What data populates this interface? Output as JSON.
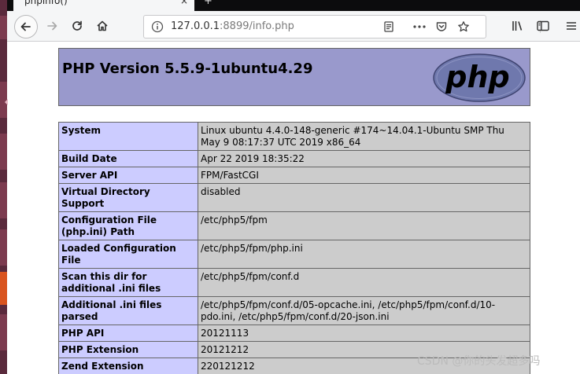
{
  "browser": {
    "tab_title": "phpinfo()",
    "tab_close": "×",
    "tab_new": "+",
    "url_host": "127.0.0.1",
    "url_rest": ":8899/info.php",
    "icons": [
      "back-icon",
      "forward-icon",
      "reload-icon",
      "home-icon",
      "info-icon",
      "reader-view-icon",
      "more-icon",
      "pocket-icon",
      "bookmark-star-icon",
      "library-icon",
      "sidebar-icon",
      "menu-icon"
    ]
  },
  "page": {
    "title": "PHP Version 5.5.9-1ubuntu4.29",
    "logo_text": "php",
    "rows": [
      {
        "key": "System",
        "value": "Linux ubuntu 4.4.0-148-generic #174~14.04.1-Ubuntu SMP Thu May 9 08:17:37 UTC 2019 x86_64"
      },
      {
        "key": "Build Date",
        "value": "Apr 22 2019 18:35:22"
      },
      {
        "key": "Server API",
        "value": "FPM/FastCGI"
      },
      {
        "key": "Virtual Directory Support",
        "value": "disabled"
      },
      {
        "key": "Configuration File (php.ini) Path",
        "value": "/etc/php5/fpm"
      },
      {
        "key": "Loaded Configuration File",
        "value": "/etc/php5/fpm/php.ini"
      },
      {
        "key": "Scan this dir for additional .ini files",
        "value": "/etc/php5/fpm/conf.d"
      },
      {
        "key": "Additional .ini files parsed",
        "value": "/etc/php5/fpm/conf.d/05-opcache.ini, /etc/php5/fpm/conf.d/10-pdo.ini, /etc/php5/fpm/conf.d/20-json.ini"
      },
      {
        "key": "PHP API",
        "value": "20121113"
      },
      {
        "key": "PHP Extension",
        "value": "20121212"
      },
      {
        "key": "Zend Extension",
        "value": "220121212"
      }
    ]
  },
  "watermark": "CSDN @你的头发超多吗",
  "colors": {
    "header_bg": "#9999cc",
    "key_bg": "#ccccff",
    "value_bg": "#cccccc",
    "launcher": "#5a2a3c"
  }
}
